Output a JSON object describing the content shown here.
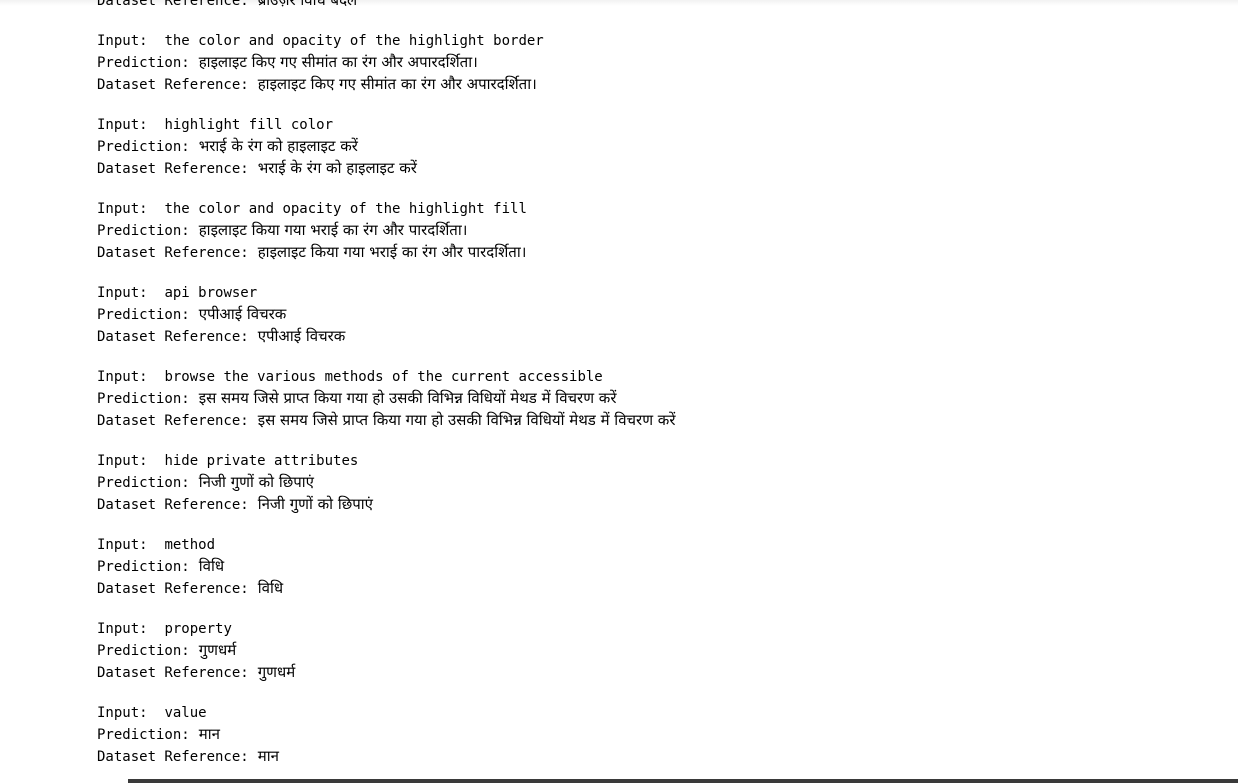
{
  "labels": {
    "input": "Input:  ",
    "prediction": "Prediction:",
    "reference": "Dataset Reference:"
  },
  "entries": [
    {
      "input": "",
      "prediction": "",
      "reference": "ब्राउज़र विधि बदलें"
    },
    {
      "input": "the color and opacity of the highlight border",
      "prediction": "हाइलाइट किए गए सीमांत का रंग और अपारदर्शिता।",
      "reference": "हाइलाइट किए गए सीमांत का रंग और अपारदर्शिता।"
    },
    {
      "input": "highlight fill color",
      "prediction": "भराई के रंग को हाइलाइट करें",
      "reference": "भराई के रंग को हाइलाइट करें"
    },
    {
      "input": "the color and opacity of the highlight fill",
      "prediction": "हाइलाइट किया गया भराई का रंग और पारदर्शिता।",
      "reference": "हाइलाइट किया गया भराई का रंग और पारदर्शिता।"
    },
    {
      "input": "api browser",
      "prediction": "एपीआई विचरक",
      "reference": "एपीआई विचरक"
    },
    {
      "input": "browse the various methods of the current accessible",
      "prediction": "इस समय जिसे प्राप्त किया गया हो उसकी विभिन्न विधियों मेथड में विचरण करें",
      "reference": "इस समय जिसे प्राप्त किया गया हो उसकी विभिन्न विधियों मेथड में विचरण करें"
    },
    {
      "input": "hide private attributes",
      "prediction": "निजी गुणों को छिपाएं",
      "reference": "निजी गुणों को छिपाएं"
    },
    {
      "input": "method",
      "prediction": "विधि",
      "reference": "विधि"
    },
    {
      "input": "property",
      "prediction": "गुणधर्म",
      "reference": "गुणधर्म"
    },
    {
      "input": "value",
      "prediction": "मान",
      "reference": "मान"
    }
  ]
}
